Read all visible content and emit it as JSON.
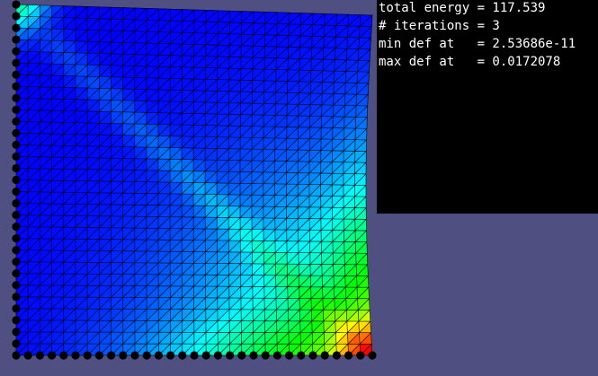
{
  "stats": {
    "total_energy": "total energy = 117.539",
    "iterations": "# iterations = 3",
    "min_def": "min def at   = 2.53686e-11",
    "max_def": "max def at   = 0.0172078"
  },
  "colors": {
    "background": "#4f4f82",
    "panel": "#000000",
    "panel_text": "#ffffff",
    "mesh_lines": "#000000",
    "constraint_dots": "#000000",
    "colormap": [
      "#0000ff",
      "#00ffff",
      "#00ff00",
      "#ffff00",
      "#ff0000"
    ]
  },
  "mesh": {
    "grid_cells": 30,
    "colormap_name": "blue-cyan-green-yellow-red deformation",
    "fixed_boundary": [
      "left edge",
      "bottom edge"
    ]
  }
}
